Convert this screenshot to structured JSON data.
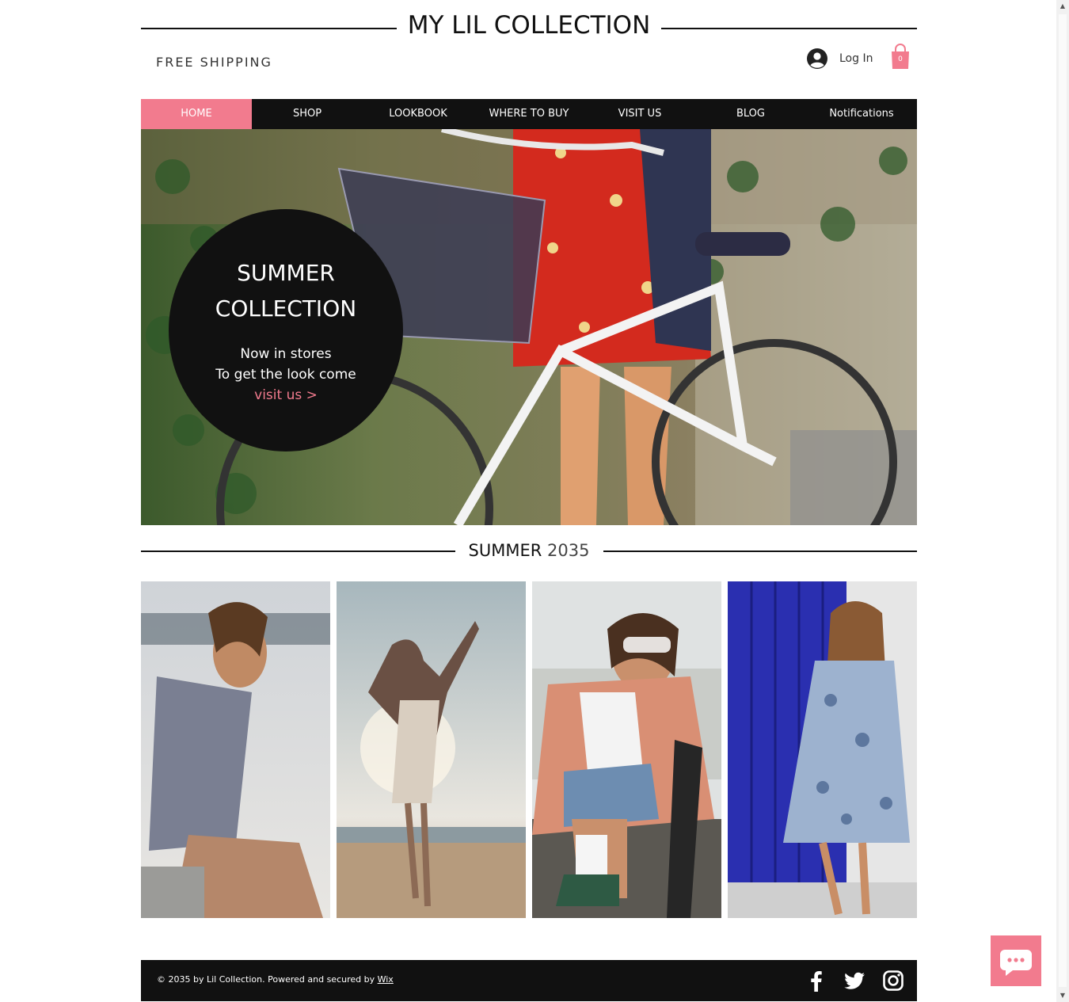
{
  "header": {
    "site_title": "MY LIL COLLECTION",
    "free_shipping": "FREE SHIPPING",
    "login_label": "Log In",
    "cart_count": "0"
  },
  "nav": {
    "items": [
      "HOME",
      "SHOP",
      "LOOKBOOK",
      "WHERE TO BUY",
      "VISIT US",
      "BLOG",
      "Notifications"
    ],
    "active": "HOME"
  },
  "hero": {
    "title_line1": "SUMMER",
    "title_line2": "COLLECTION",
    "sub_line1": "Now in stores",
    "sub_line2": "To get the look come",
    "link": "visit us >"
  },
  "section": {
    "title_word": "SUMMER",
    "title_year": "2035"
  },
  "footer": {
    "copyright": "© 2035 by Lil Collection. Powered and secured by",
    "wix_link": "Wix",
    "social": [
      "facebook-icon",
      "twitter-icon",
      "instagram-icon"
    ]
  },
  "colors": {
    "accent": "#f27b8e",
    "dark": "#111111"
  }
}
